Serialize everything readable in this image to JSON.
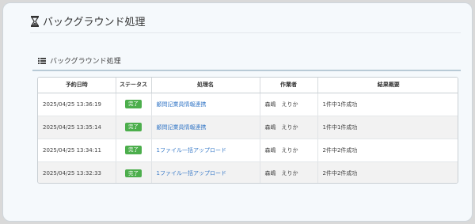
{
  "header": {
    "title": "バックグラウンド処理",
    "icon": "hourglass-icon"
  },
  "section": {
    "title": "バックグラウンド処理",
    "icon": "list-icon"
  },
  "table": {
    "columns": [
      "予約日時",
      "ステータス",
      "処理名",
      "作業者",
      "結果概要"
    ],
    "rows": [
      {
        "datetime": "2025/04/25 13:36:19",
        "status": "完了",
        "name": "顧問記業員情報連携",
        "worker": "森嶋　えりか",
        "result": "1件中1件成功"
      },
      {
        "datetime": "2025/04/25 13:35:14",
        "status": "完了",
        "name": "顧問記業員情報連携",
        "worker": "森嶋　えりか",
        "result": "1件中1件成功"
      },
      {
        "datetime": "2025/04/25 13:34:11",
        "status": "完了",
        "name": "1ファイル一括アップロード",
        "worker": "森嶋　えりか",
        "result": "2件中2件成功"
      },
      {
        "datetime": "2025/04/25 13:32:33",
        "status": "完了",
        "name": "1ファイル一括アップロード",
        "worker": "森嶋　えりか",
        "result": "2件中2件成功"
      }
    ]
  },
  "colors": {
    "success": "#4cae4c",
    "link": "#3a7bc8",
    "background": "#f5f9fc"
  }
}
